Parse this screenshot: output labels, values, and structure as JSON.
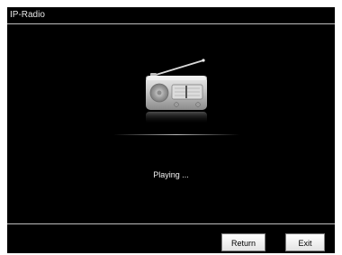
{
  "window": {
    "title": "IP-Radio"
  },
  "main": {
    "status_text": "Playing ...",
    "icon": "radio-icon"
  },
  "footer": {
    "return_label": "Return",
    "exit_label": "Exit"
  },
  "colors": {
    "background": "#000000",
    "text": "#f2f2f2",
    "button_face": "#f0f0f0"
  }
}
